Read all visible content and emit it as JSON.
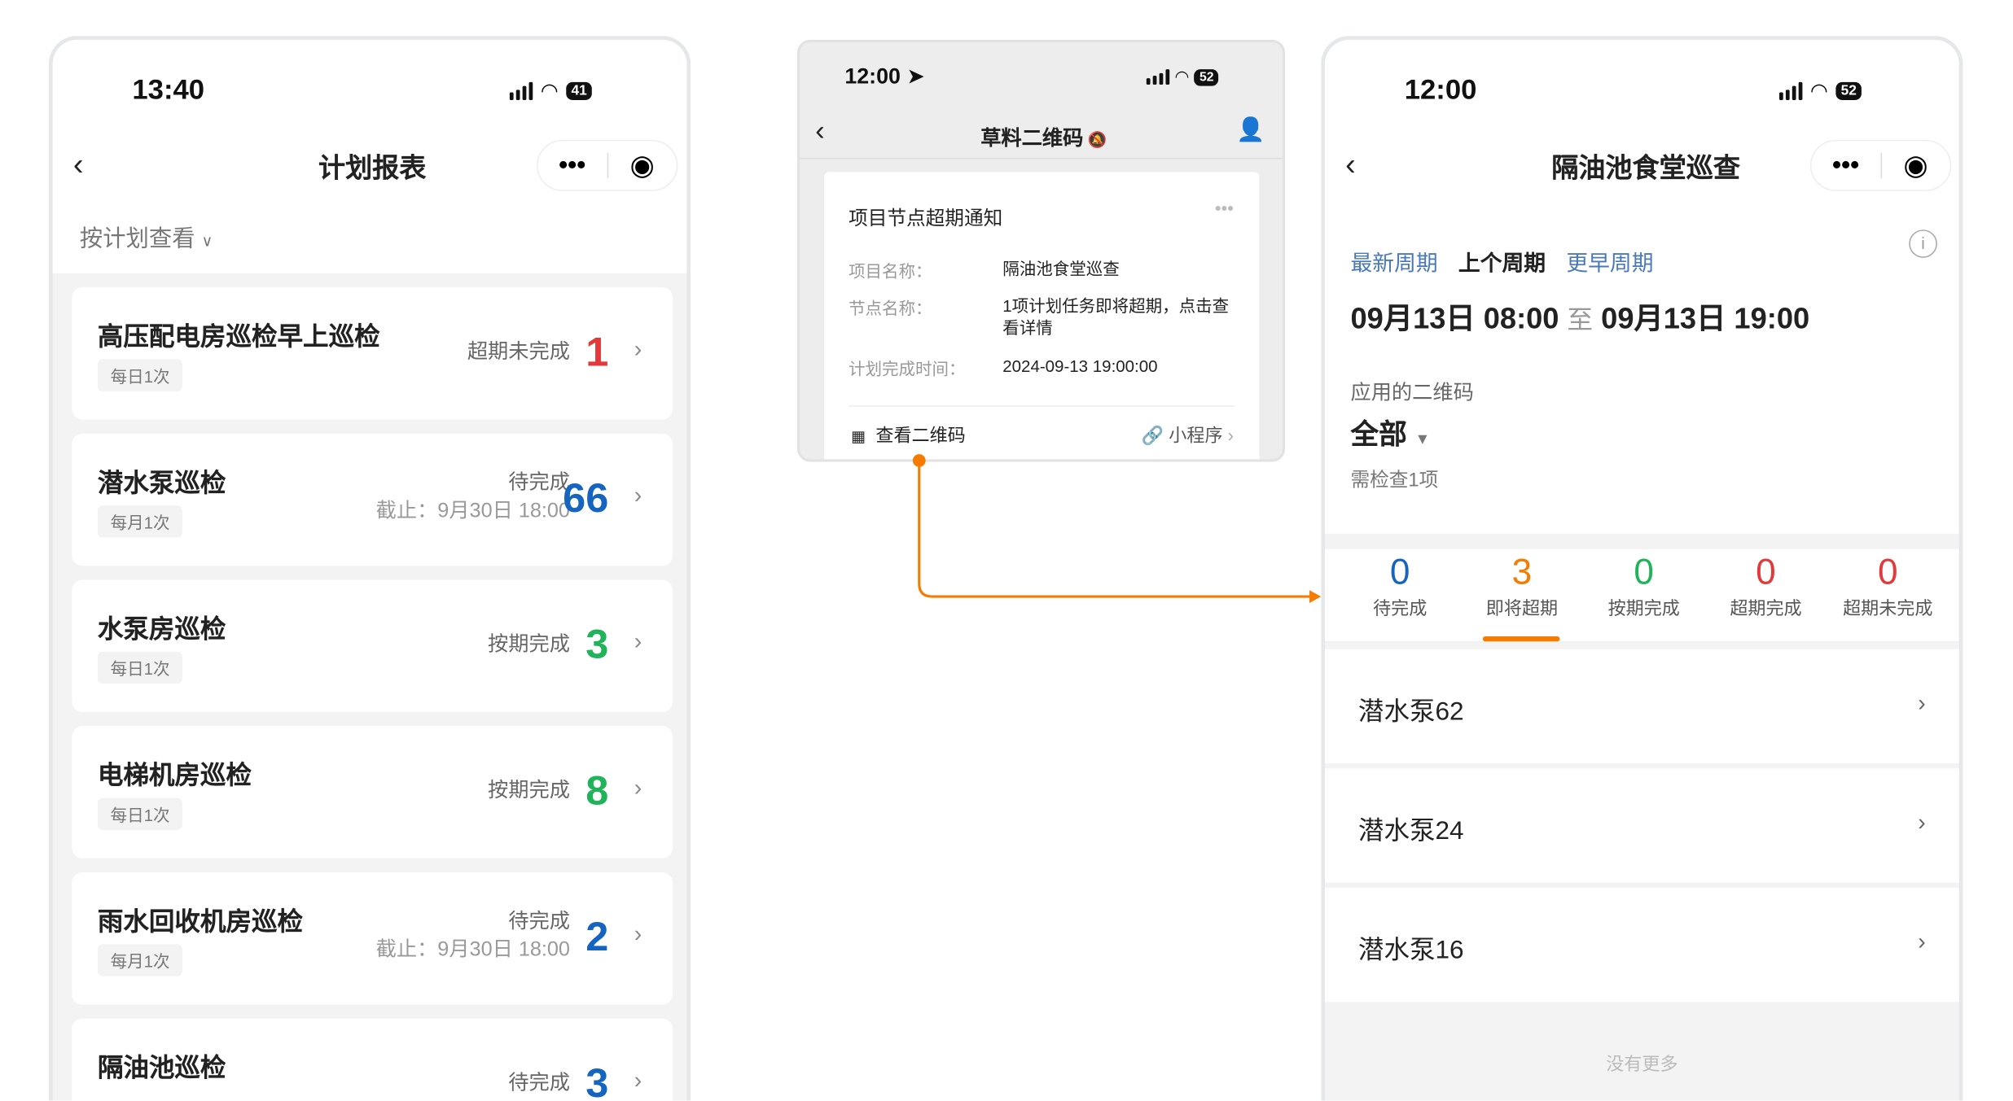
{
  "left_phone": {
    "status_time": "13:40",
    "battery": "41",
    "title": "计划报表",
    "filter_label": "按计划查看",
    "cards": [
      {
        "title": "高压配电房巡检早上巡检",
        "tag": "每日1次",
        "status": "超期未完成",
        "deadline": "",
        "count": "1",
        "color": "#e23a3a"
      },
      {
        "title": "潜水泵巡检",
        "tag": "每月1次",
        "status": "待完成",
        "deadline": "截止：9月30日 18:00",
        "count": "66",
        "color": "#1565c0"
      },
      {
        "title": "水泵房巡检",
        "tag": "每日1次",
        "status": "按期完成",
        "deadline": "",
        "count": "3",
        "color": "#20b35a"
      },
      {
        "title": "电梯机房巡检",
        "tag": "每日1次",
        "status": "按期完成",
        "deadline": "",
        "count": "8",
        "color": "#20b35a"
      },
      {
        "title": "雨水回收机房巡检",
        "tag": "每月1次",
        "status": "待完成",
        "deadline": "截止：9月30日 18:00",
        "count": "2",
        "color": "#1565c0"
      },
      {
        "title": "隔油池巡检",
        "tag": "",
        "status": "待完成",
        "deadline": "",
        "count": "3",
        "color": "#1565c0"
      }
    ]
  },
  "middle_phone": {
    "status_time": "12:00",
    "battery": "52",
    "title": "草料二维码",
    "card_title": "项目节点超期通知",
    "rows": [
      {
        "label": "项目名称：",
        "value": "隔油池食堂巡查"
      },
      {
        "label": "节点名称：",
        "value": "1项计划任务即将超期，点击查看详情"
      },
      {
        "label": "计划完成时间：",
        "value": "2024-09-13 19:00:00"
      }
    ],
    "view_qr": "查看二维码",
    "mini_program": "小程序"
  },
  "right_phone": {
    "status_time": "12:00",
    "battery": "52",
    "title": "隔油池食堂巡查",
    "period_tabs": [
      "最新周期",
      "上个周期",
      "更早周期"
    ],
    "active_period": "上个周期",
    "date_start": "09月13日 08:00",
    "date_sep": "至",
    "date_end": "09月13日 19:00",
    "qr_label": "应用的二维码",
    "qr_value": "全部",
    "need_check": "需检查1项",
    "stats": [
      {
        "value": "0",
        "label": "待完成",
        "color": "#1565c0"
      },
      {
        "value": "3",
        "label": "即将超期",
        "color": "#f57c00"
      },
      {
        "value": "0",
        "label": "按期完成",
        "color": "#20b35a"
      },
      {
        "value": "0",
        "label": "超期完成",
        "color": "#e23a3a"
      },
      {
        "value": "0",
        "label": "超期未完成",
        "color": "#e23a3a"
      }
    ],
    "active_stat": "即将超期",
    "items": [
      "潜水泵62",
      "潜水泵24",
      "潜水泵16"
    ],
    "no_more": "没有更多"
  },
  "connector_color": "#f57c00"
}
